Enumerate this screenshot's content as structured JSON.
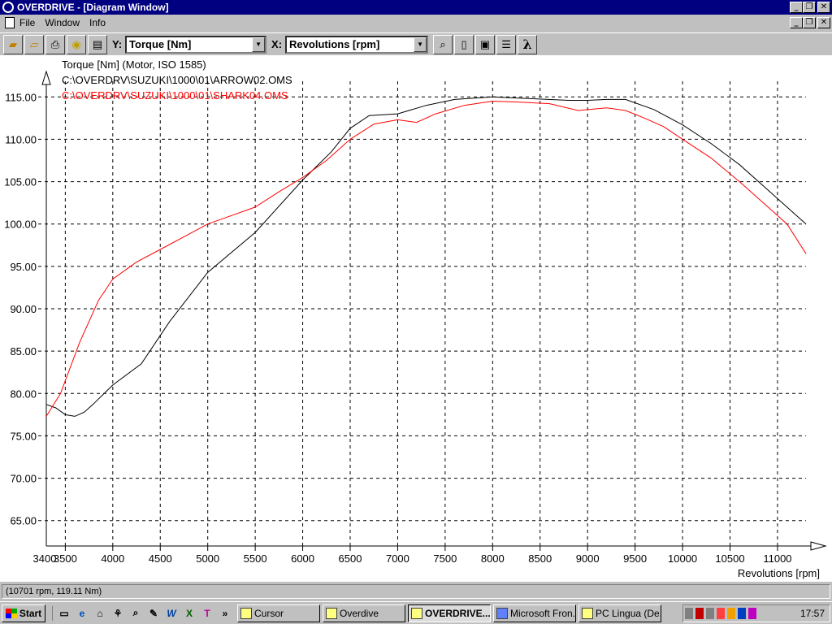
{
  "window": {
    "title": "OVERDRIVE - [Diagram Window]"
  },
  "menu": {
    "items": [
      "File",
      "Window",
      "Info"
    ]
  },
  "toolbar": {
    "y_label": "Y:",
    "y_value": "Torque [Nm]",
    "x_label": "X:",
    "x_value": "Revolutions [rpm]",
    "lambda": "λ"
  },
  "chart_data": {
    "type": "line",
    "title": "Torque [Nm] (Motor, ISO 1585)",
    "xlabel": "Revolutions [rpm]",
    "ylabel": "",
    "xlim": [
      3300,
      11300
    ],
    "ylim": [
      62,
      118
    ],
    "grid": true,
    "x_ticks": [
      3500,
      4000,
      4500,
      5000,
      5500,
      6000,
      6500,
      7000,
      7500,
      8000,
      8500,
      9000,
      9500,
      10000,
      10500,
      11000
    ],
    "x_tick_labels": [
      "3500",
      "4000",
      "4500",
      "5000",
      "5500",
      "6000",
      "6500",
      "7000",
      "7500",
      "8000",
      "8500",
      "9000",
      "9500",
      "10000",
      "10500",
      "11000"
    ],
    "y_ticks": [
      65,
      70,
      75,
      80,
      85,
      90,
      95,
      100,
      105,
      110,
      115
    ],
    "y_tick_labels": [
      "65.00",
      "70.00",
      "75.00",
      "80.00",
      "85.00",
      "90.00",
      "95.00",
      "100.00",
      "105.00",
      "110.00",
      "115.00"
    ],
    "edge_labels": {
      "x_start": "3400"
    },
    "series": [
      {
        "name": "C:\\OVERDRV\\SUZUKI\\1000\\01\\ARROW02.OMS",
        "color": "#000000",
        "x": [
          3300,
          3400,
          3500,
          3600,
          3700,
          3800,
          4000,
          4300,
          4600,
          5000,
          5500,
          6000,
          6300,
          6500,
          6700,
          7000,
          7300,
          7600,
          8000,
          8400,
          8800,
          9000,
          9200,
          9400,
          9700,
          10000,
          10300,
          10600,
          10900,
          11150,
          11300
        ],
        "y": [
          78.7,
          78.3,
          77.5,
          77.3,
          77.8,
          78.8,
          81.0,
          83.5,
          88.5,
          94.3,
          99.0,
          105.2,
          108.5,
          111.3,
          112.8,
          113.0,
          114.0,
          114.7,
          115.0,
          114.8,
          114.6,
          114.6,
          114.7,
          114.7,
          113.5,
          111.7,
          109.5,
          107.0,
          104.0,
          101.5,
          100.0
        ]
      },
      {
        "name": "C:\\OVERDRV\\SUZUKI\\1000\\01\\SHARK04.OMS",
        "color": "#ff0000",
        "x": [
          3300,
          3450,
          3650,
          3850,
          4000,
          4250,
          4500,
          4750,
          5000,
          5250,
          5500,
          5750,
          6000,
          6250,
          6500,
          6750,
          7000,
          7200,
          7400,
          7700,
          8000,
          8250,
          8600,
          8900,
          9200,
          9400,
          9600,
          9800,
          10000,
          10300,
          10600,
          10900,
          11100,
          11300
        ],
        "y": [
          77.3,
          80.0,
          86.0,
          91.0,
          93.5,
          95.5,
          97.0,
          98.5,
          100.0,
          101.0,
          102.0,
          103.8,
          105.5,
          107.5,
          110.0,
          111.8,
          112.3,
          112.0,
          113.0,
          114.0,
          114.5,
          114.4,
          114.2,
          113.4,
          113.7,
          113.4,
          112.5,
          111.5,
          110.0,
          107.8,
          105.0,
          102.0,
          100.0,
          96.5
        ]
      }
    ]
  },
  "status": {
    "text": "(10701 rpm, 119.11 Nm)"
  },
  "taskbar": {
    "start": "Start",
    "more": "»",
    "tasks": [
      "Cursor",
      "Overdive",
      "OVERDRIVE...",
      "Microsoft Fron...",
      "PC Lingua (De..."
    ],
    "active_index": 2,
    "clock": "17:57"
  }
}
